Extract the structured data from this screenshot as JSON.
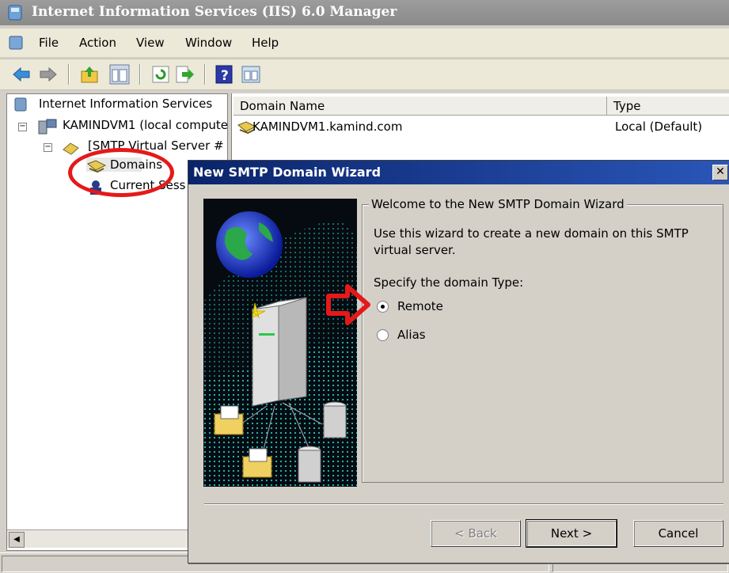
{
  "window": {
    "title": "Internet Information Services (IIS) 6.0 Manager"
  },
  "menu": {
    "items": [
      "File",
      "Action",
      "View",
      "Window",
      "Help"
    ]
  },
  "toolbar": {
    "icons": [
      "back-icon",
      "forward-icon",
      "up-icon",
      "show-hide-tree-icon",
      "refresh-icon",
      "export-icon",
      "help-icon",
      "properties-icon"
    ]
  },
  "tree": {
    "root": "Internet Information Services",
    "computer": "KAMINDVM1 (local compute",
    "smtp": "[SMTP Virtual Server #",
    "domains": "Domains",
    "sessions": "Current Sess"
  },
  "list": {
    "columns": [
      "Domain Name",
      "Type"
    ],
    "rows": [
      {
        "name": "KAMINDVM1.kamind.com",
        "type": "Local (Default)"
      }
    ]
  },
  "wizard": {
    "title": "New SMTP Domain Wizard",
    "close": "✕",
    "group_title": "Welcome to the New SMTP Domain Wizard",
    "description": "Use this wizard to create a new domain on this SMTP virtual server.",
    "prompt": "Specify the domain Type:",
    "options": [
      {
        "label": "Remote",
        "selected": true
      },
      {
        "label": "Alias",
        "selected": false
      }
    ],
    "buttons": {
      "back": "< Back",
      "next": "Next >",
      "cancel": "Cancel"
    }
  },
  "annotations": {
    "color": "#e4191a"
  },
  "colors": {
    "title_active": "#0a246a",
    "title_inactive": "#8a8a8a",
    "face": "#d4d0c8"
  }
}
